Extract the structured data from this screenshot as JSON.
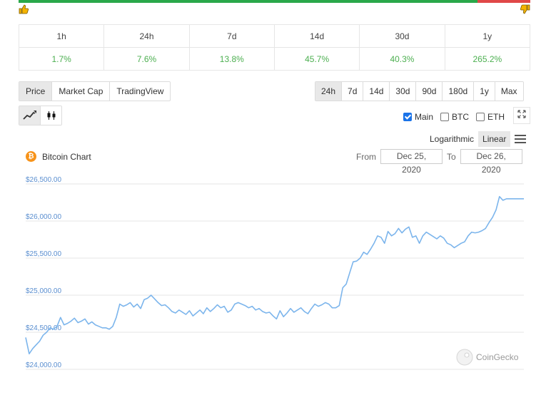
{
  "sentiment": {
    "up_color": "#2aa84a",
    "down_color": "#e04848",
    "up_icon": "thumbs-up-icon",
    "down_icon": "thumbs-down-icon"
  },
  "performance": {
    "headers": [
      "1h",
      "24h",
      "7d",
      "14d",
      "30d",
      "1y"
    ],
    "values": [
      "1.7%",
      "7.6%",
      "13.8%",
      "45.7%",
      "40.3%",
      "265.2%"
    ],
    "value_color": "#4caf50"
  },
  "chart_tabs": {
    "items": [
      "Price",
      "Market Cap",
      "TradingView"
    ],
    "active": "Price"
  },
  "range_tabs": {
    "items": [
      "24h",
      "7d",
      "14d",
      "30d",
      "90d",
      "180d",
      "1y",
      "Max"
    ],
    "active": "24h"
  },
  "chart_type": {
    "items": [
      "line-chart-icon",
      "candlestick-icon"
    ],
    "active": "line-chart-icon"
  },
  "overlays": [
    {
      "label": "Main",
      "checked": true
    },
    {
      "label": "BTC",
      "checked": false
    },
    {
      "label": "ETH",
      "checked": false
    }
  ],
  "scale": {
    "options": [
      "Logarithmic",
      "Linear"
    ],
    "active": "Linear"
  },
  "date_range": {
    "from_label": "From",
    "from_value": "Dec 25, 2020",
    "to_label": "To",
    "to_value": "Dec 26, 2020"
  },
  "watermark": "CoinGecko",
  "chart_data": {
    "type": "line",
    "title": "Bitcoin Chart",
    "ylim": [
      24000,
      26500
    ],
    "yticks": [
      24000,
      24500,
      25000,
      25500,
      26000,
      26500
    ],
    "ytick_labels": [
      "$24,000.00",
      "$24,500.00",
      "$25,000.00",
      "$25,500.00",
      "$26,000.00",
      "$26,500.00"
    ],
    "grid": true,
    "line_color": "#7cb5ec",
    "x": [
      0,
      1,
      2,
      3,
      4,
      5,
      6,
      7,
      8,
      9,
      10,
      11,
      12,
      13,
      14,
      15,
      16,
      17,
      18,
      19,
      20,
      21,
      22,
      23,
      24,
      25,
      26,
      27,
      28,
      29,
      30,
      31,
      32,
      33,
      34,
      35,
      36,
      37,
      38,
      39,
      40,
      41,
      42,
      43,
      44,
      45,
      46,
      47,
      48,
      49,
      50,
      51,
      52,
      53,
      54,
      55,
      56,
      57,
      58,
      59,
      60,
      61,
      62,
      63,
      64,
      65,
      66,
      67,
      68,
      69,
      70,
      71,
      72,
      73,
      74,
      75,
      76,
      77,
      78,
      79,
      80,
      81,
      82,
      83,
      84,
      85,
      86,
      87,
      88,
      89,
      90,
      91,
      92,
      93,
      94,
      95,
      96,
      97,
      98,
      99,
      100,
      101,
      102,
      103,
      104,
      105,
      106,
      107,
      108,
      109,
      110,
      111,
      112,
      113,
      114,
      115,
      116,
      117,
      118,
      119,
      120,
      121,
      122,
      123,
      124,
      125,
      126,
      127,
      128,
      129,
      130,
      131,
      132,
      133,
      134,
      135,
      136,
      137,
      138,
      139,
      140,
      141,
      142,
      143
    ],
    "y": [
      24430,
      24210,
      24280,
      24330,
      24380,
      24460,
      24500,
      24560,
      24540,
      24580,
      24700,
      24600,
      24620,
      24650,
      24690,
      24630,
      24650,
      24680,
      24610,
      24640,
      24600,
      24580,
      24560,
      24560,
      24540,
      24580,
      24700,
      24880,
      24850,
      24870,
      24900,
      24840,
      24880,
      24820,
      24940,
      24960,
      25000,
      24950,
      24900,
      24860,
      24870,
      24830,
      24780,
      24760,
      24800,
      24770,
      24740,
      24790,
      24720,
      24760,
      24800,
      24750,
      24830,
      24780,
      24820,
      24870,
      24830,
      24850,
      24770,
      24800,
      24880,
      24900,
      24880,
      24860,
      24830,
      24850,
      24800,
      24820,
      24780,
      24760,
      24770,
      24720,
      24680,
      24790,
      24710,
      24760,
      24820,
      24770,
      24800,
      24830,
      24780,
      24750,
      24820,
      24880,
      24850,
      24870,
      24900,
      24880,
      24830,
      24830,
      24860,
      25100,
      25150,
      25300,
      25450,
      25460,
      25500,
      25580,
      25550,
      25620,
      25700,
      25800,
      25780,
      25700,
      25860,
      25800,
      25830,
      25900,
      25840,
      25890,
      25920,
      25780,
      25800,
      25700,
      25800,
      25850,
      25820,
      25790,
      25760,
      25800,
      25770,
      25700,
      25680,
      25640,
      25670,
      25700,
      25720,
      25800,
      25850,
      25840,
      25850,
      25870,
      25900,
      25980,
      26050,
      26150,
      26330,
      26280,
      26300,
      26300,
      26300,
      26300,
      26300,
      26300
    ]
  }
}
